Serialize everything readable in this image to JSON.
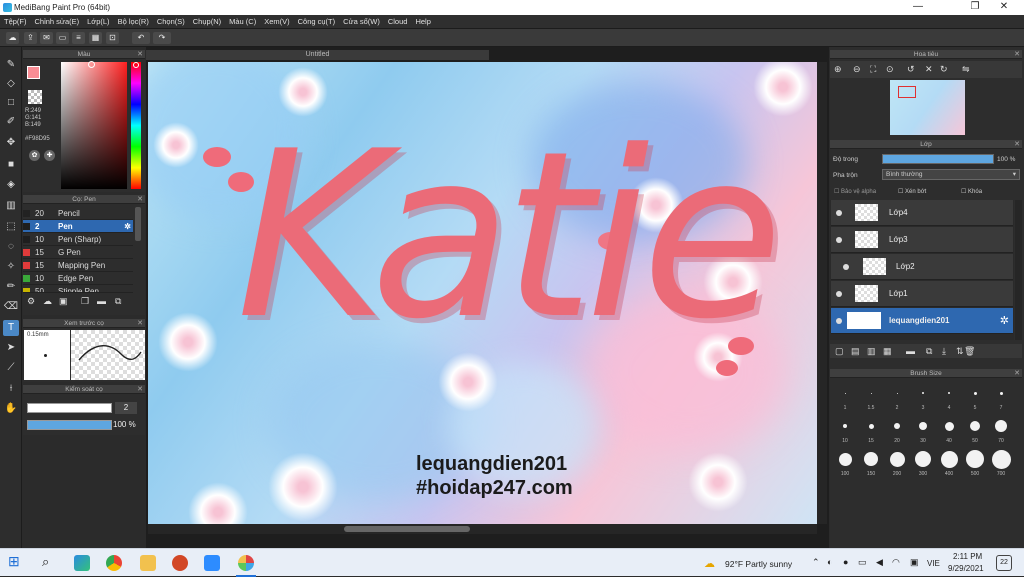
{
  "window": {
    "title": "MediBang Paint Pro (64bit)",
    "minimize": "—",
    "maximize": "❐",
    "close": "✕"
  },
  "menu": [
    "Tệp(F)",
    "Chỉnh sửa(E)",
    "Lớp(L)",
    "Bộ lọc(R)",
    "Chọn(S)",
    "Chụp(N)",
    "Màu (C)",
    "Xem(V)",
    "Công cụ(T)",
    "Cửa sổ(W)",
    "Cloud",
    "Help"
  ],
  "toolbar": {
    "undo": "↶",
    "redo": "↷"
  },
  "color_panel": {
    "title": "Màu",
    "foreground": "#F98D95",
    "readout": {
      "r": "R:249",
      "g": "G:141",
      "b": "B:149"
    },
    "hex": "#F98D95"
  },
  "brush_panel": {
    "title": "Cọ: Pen",
    "brushes": [
      {
        "size": "20",
        "name": "Pencil",
        "color": "#222222",
        "selected": false
      },
      {
        "size": "2",
        "name": "Pen",
        "color": "#1e1e1e",
        "selected": true
      },
      {
        "size": "10",
        "name": "Pen (Sharp)",
        "color": "#1e1e1e",
        "selected": false
      },
      {
        "size": "15",
        "name": "G Pen",
        "color": "#e03b3b",
        "selected": false
      },
      {
        "size": "15",
        "name": "Mapping Pen",
        "color": "#e03b3b",
        "selected": false
      },
      {
        "size": "10",
        "name": "Edge Pen",
        "color": "#3aa83a",
        "selected": false
      },
      {
        "size": "50",
        "name": "Stipple Pen",
        "color": "#c8b400",
        "selected": false
      }
    ]
  },
  "preview_panel": {
    "title": "Xem trước cọ",
    "size_label": "0.15mm"
  },
  "control_panel": {
    "title": "Kiểm soát cọ",
    "size_value": "2",
    "opacity_value": "100 %"
  },
  "document": {
    "tab": "Untitled"
  },
  "artwork": {
    "title_text": "Katie",
    "watermark_1": "lequangdien201",
    "watermark_2": "#hoidap247.com"
  },
  "navigator": {
    "title": "Hoa tiêu"
  },
  "layer_panel": {
    "title": "Lớp",
    "opacity_label": "Độ trong",
    "opacity_value": "100 %",
    "blend_label": "Pha trộn",
    "blend_value": "Bình thường",
    "opacity_fraction": 1.0,
    "checks": [
      "Bảo vệ alpha",
      "Xén bớt",
      "Khóa"
    ],
    "layers": [
      {
        "name": "Lớp4",
        "selected": false
      },
      {
        "name": "Lớp3",
        "selected": false
      },
      {
        "name": "Lớp2",
        "selected": false
      },
      {
        "name": "Lớp1",
        "selected": false
      },
      {
        "name": "lequangdien201",
        "selected": true
      }
    ]
  },
  "brush_size_panel": {
    "title": "Brush Size",
    "sizes": [
      "1",
      "1.5",
      "2",
      "3",
      "4",
      "5",
      "7",
      "10",
      "15",
      "20",
      "30",
      "40",
      "50",
      "70",
      "100",
      "150",
      "200",
      "300",
      "400",
      "500",
      "700"
    ]
  },
  "taskbar": {
    "weather": "92°F  Partly sunny",
    "lang": "VIE",
    "time": "2:11 PM",
    "date": "9/29/2021",
    "notifications": "22"
  }
}
